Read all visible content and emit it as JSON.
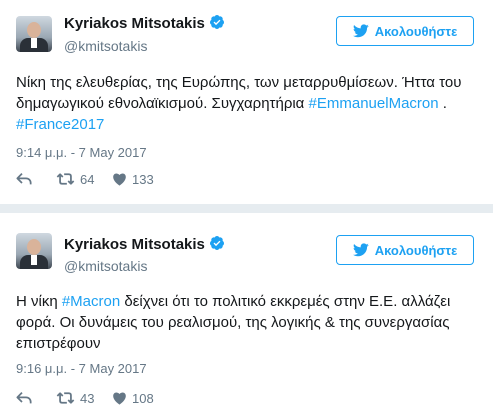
{
  "tweets": [
    {
      "author_name": "Kyriakos Mitsotakis",
      "handle": "@kmitsotakis",
      "follow_label": "Ακολουθήστε",
      "text_part1": "Νίκη της ελευθερίας, της Ευρώπης, των μεταρρυθμίσεων. Ήττα του δημαγωγικού εθνολαϊκισμού. Συγχαρητήρια ",
      "hashtag1": "#EmmanuelMacron",
      "text_part2": " . ",
      "hashtag2": "#France2017",
      "timestamp": "9:14 μ.μ. - 7 May 2017",
      "retweets": "64",
      "likes": "133"
    },
    {
      "author_name": "Kyriakos Mitsotakis",
      "handle": "@kmitsotakis",
      "follow_label": "Ακολουθήστε",
      "text_part1": "Η νίκη ",
      "hashtag1": "#Macron",
      "text_part2": " δείχνει ότι το πολιτικό εκκρεμές στην Ε.Ε. αλλάζει φορά. Οι δυνάμεις του ρεαλισμού, της λογικής & της συνεργασίας επιστρέφουν",
      "timestamp": "9:16 μ.μ. - 7 May 2017",
      "retweets": "43",
      "likes": "108"
    }
  ],
  "colors": {
    "accent": "#1da1f2",
    "muted": "#657786",
    "divider": "#e6ecf0"
  },
  "icons": [
    "verified-badge-icon",
    "twitter-bird-icon",
    "reply-icon",
    "retweet-icon",
    "heart-icon"
  ]
}
